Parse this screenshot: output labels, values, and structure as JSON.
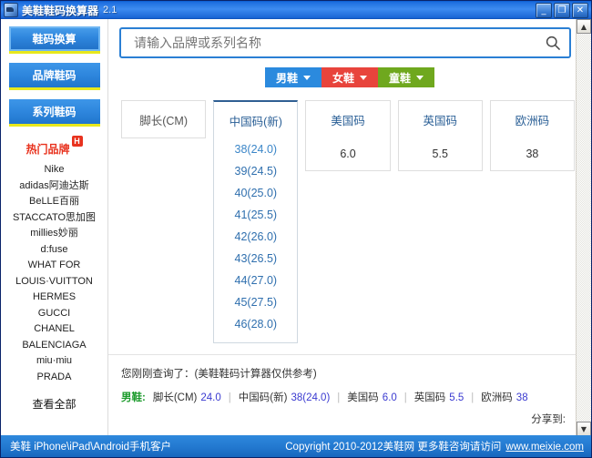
{
  "window": {
    "title": "美鞋鞋码换算器",
    "version": "2.1",
    "icon": "app-icon",
    "controls": {
      "minimize": "_",
      "maximize": "❐",
      "close": "✕"
    }
  },
  "sidebar": {
    "nav": [
      {
        "label": "鞋码换算",
        "active": true
      },
      {
        "label": "品牌鞋码",
        "active": false
      },
      {
        "label": "系列鞋码",
        "active": false
      }
    ],
    "hot_brands_label": "热门品牌",
    "hot_badge": "H",
    "brands": [
      "Nike",
      "adidas阿迪达斯",
      "BeLLE百丽",
      "STACCATO思加图",
      "millies妙丽",
      "d:fuse",
      "WHAT FOR",
      "LOUIS·VUITTON",
      "HERMES",
      "GUCCI",
      "CHANEL",
      "BALENCIAGA",
      "miu·miu",
      "PRADA"
    ],
    "view_all": "查看全部"
  },
  "search": {
    "placeholder": "请输入品牌或系列名称",
    "value": "",
    "icon": "search-icon"
  },
  "tabs": [
    {
      "label": "男鞋",
      "color": "#2b8ade",
      "active": true
    },
    {
      "label": "女鞋",
      "color": "#e8443c",
      "active": false
    },
    {
      "label": "童鞋",
      "color": "#6fa81e",
      "active": false
    }
  ],
  "columns": [
    {
      "header": "脚长(CM)",
      "value": "",
      "open": false,
      "options": []
    },
    {
      "header": "中国码(新)",
      "value": "38(24.0)",
      "open": true,
      "options": [
        "38(24.0)",
        "39(24.5)",
        "40(25.0)",
        "41(25.5)",
        "42(26.0)",
        "43(26.5)",
        "44(27.0)",
        "45(27.5)",
        "46(28.0)"
      ]
    },
    {
      "header": "美国码",
      "value": "6.0",
      "open": false,
      "options": []
    },
    {
      "header": "英国码",
      "value": "5.5",
      "open": false,
      "options": []
    },
    {
      "header": "欧洲码",
      "value": "38",
      "open": false,
      "options": []
    }
  ],
  "recent": {
    "title": "您刚刚查询了：(美鞋鞋码计算器仅供参考)",
    "category": "男鞋:",
    "items": [
      {
        "label": "脚长(CM)",
        "value": "24.0"
      },
      {
        "label": "中国码(新)",
        "value": "38(24.0)"
      },
      {
        "label": "美国码",
        "value": "6.0"
      },
      {
        "label": "英国码",
        "value": "5.5"
      },
      {
        "label": "欧洲码",
        "value": "38"
      }
    ],
    "separator": "|",
    "share_label": "分享到:"
  },
  "footer": {
    "left": "美鞋 iPhone\\iPad\\Android手机客户",
    "copyright": "Copyright 2010-2012美鞋网 更多鞋咨询请访问",
    "url": "www.meixie.com"
  },
  "colors": {
    "titlebar": "#2a7fd4",
    "accent_blue": "#2b8ade",
    "accent_red": "#e8443c",
    "accent_green": "#6fa81e",
    "hot": "#e8321e",
    "value_blue": "#3a3ad0"
  }
}
